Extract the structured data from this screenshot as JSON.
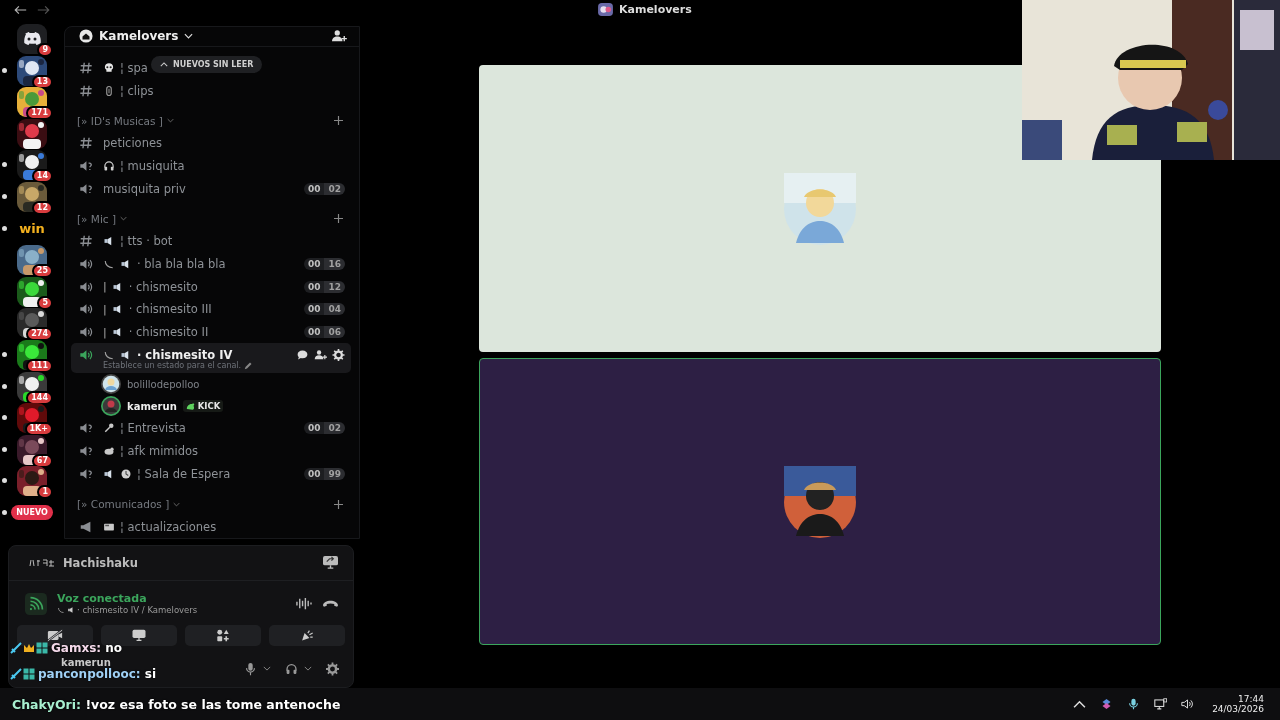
{
  "topbar": {
    "title": "Kamelovers"
  },
  "servers": [
    {
      "kind": "home",
      "badge": "9",
      "unread": false
    },
    {
      "kind": "picture",
      "badge": "13",
      "unread": true
    },
    {
      "kind": "picture",
      "badge": "171",
      "unread": false
    },
    {
      "kind": "picture",
      "unread": false
    },
    {
      "kind": "picture",
      "badge": "14",
      "unread": true
    },
    {
      "kind": "picture",
      "badge": "12",
      "unread": true
    },
    {
      "kind": "logo",
      "label": "win",
      "unread": true
    },
    {
      "kind": "picture",
      "badge": "25",
      "unread": false
    },
    {
      "kind": "picture",
      "badge": "5",
      "unread": false
    },
    {
      "kind": "picture",
      "badge": "274",
      "unread": false
    },
    {
      "kind": "picture",
      "badge": "111",
      "unread": true
    },
    {
      "kind": "picture",
      "badge": "144",
      "unread": true
    },
    {
      "kind": "picture",
      "badge": "1K+",
      "unread": true
    },
    {
      "kind": "picture",
      "badge": "67",
      "unread": true
    },
    {
      "kind": "picture",
      "badge": "1",
      "unread": true
    },
    {
      "kind": "new",
      "label": "NUEVO",
      "unread": true
    }
  ],
  "server_header": {
    "name": "Kamelovers"
  },
  "unread_pill": {
    "label": "NUEVOS SIN LEER"
  },
  "channels": [
    {
      "kind": "text",
      "deco": [
        {
          "kind": "skull"
        }
      ],
      "name": "¦ spa"
    },
    {
      "kind": "text",
      "deco": [
        {
          "kind": "clip"
        }
      ],
      "name": "¦ clips"
    },
    {
      "kind": "category",
      "name": "[» ID's Musicas ]"
    },
    {
      "kind": "text",
      "name": "peticiones"
    },
    {
      "kind": "voice",
      "locked": true,
      "deco": [
        {
          "kind": "headphones"
        }
      ],
      "name": "¦ musiquita"
    },
    {
      "kind": "voice",
      "locked": true,
      "name": "musiquita priv",
      "users": "00",
      "limit": "02"
    },
    {
      "kind": "category",
      "name": "[» Mic ]"
    },
    {
      "kind": "text",
      "deco": [
        {
          "kind": "speaker"
        }
      ],
      "name": "¦ tts · bot"
    },
    {
      "kind": "voice",
      "locked": false,
      "selected": false,
      "deco": [
        {
          "kind": "phone"
        },
        {
          "kind": "speaker"
        }
      ],
      "name": "· bla bla bla bla",
      "users": "00",
      "limit": "16"
    },
    {
      "kind": "voice",
      "locked": false,
      "selected": false,
      "prefix": "|",
      "deco": [
        {
          "kind": "speaker"
        }
      ],
      "name": "· chismesito",
      "users": "00",
      "limit": "12"
    },
    {
      "kind": "voice",
      "locked": false,
      "selected": false,
      "prefix": "|",
      "deco": [
        {
          "kind": "speaker"
        }
      ],
      "name": "· chismesito III",
      "users": "00",
      "limit": "04"
    },
    {
      "kind": "voice",
      "locked": false,
      "selected": false,
      "prefix": "|",
      "deco": [
        {
          "kind": "speaker"
        }
      ],
      "name": "· chismesito II",
      "users": "00",
      "limit": "06"
    },
    {
      "kind": "voice",
      "locked": false,
      "selected": true,
      "deco": [
        {
          "kind": "phone"
        },
        {
          "kind": "speaker"
        }
      ],
      "name": "· chismesito IV",
      "status": "Establece un estado para el canal.",
      "members": [
        {
          "name": "bolillodepolloo",
          "speaking": false
        },
        {
          "name": "kamerun",
          "speaking": true,
          "tag": "KICK"
        }
      ]
    },
    {
      "kind": "voice",
      "locked": true,
      "deco": [
        {
          "kind": "mic"
        }
      ],
      "name": "¦ Entrevista",
      "users": "00",
      "limit": "02"
    },
    {
      "kind": "voice",
      "locked": true,
      "deco": [
        {
          "kind": "bird"
        }
      ],
      "name": "¦ afk mimidos"
    },
    {
      "kind": "voice",
      "locked": true,
      "deco": [
        {
          "kind": "speaker"
        },
        {
          "kind": "clock"
        }
      ],
      "name": "¦ Sala de Espera",
      "users": "00",
      "limit": "99"
    },
    {
      "kind": "category",
      "name": "[» Comunicados ]"
    },
    {
      "kind": "announce",
      "deco": [
        {
          "kind": "card"
        }
      ],
      "name": "¦ actualizaciones"
    }
  ],
  "hub": {
    "name": "Hachishaku"
  },
  "voice": {
    "status": "Voz conectada",
    "location": "· chismesito IV / Kamelovers"
  },
  "user": {
    "name": "kamerun"
  },
  "stage": [
    {
      "color": "#dce6dc",
      "speaking": false
    },
    {
      "color": "#2d1f44",
      "speaking": true
    }
  ],
  "chat": [
    {
      "user": "Gamxs:",
      "text": "no",
      "color": "#f4d9ea",
      "crown": true
    },
    {
      "user": "panconpollooc:",
      "text": "si",
      "color": "#9fd0f5",
      "crown": false
    }
  ],
  "ticker": {
    "user": "ChakyOri:",
    "text": "!voz esa foto se las tome antenoche",
    "color": "#a8f0d0"
  },
  "tray": {
    "time": "17:44",
    "date": "24/03/2026"
  }
}
